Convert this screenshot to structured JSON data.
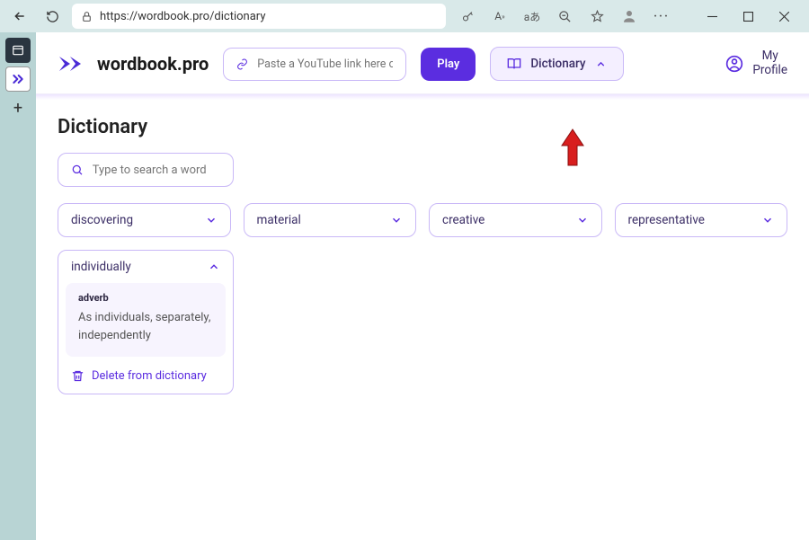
{
  "browser": {
    "url": "https://wordbook.pro/dictionary"
  },
  "header": {
    "logo_text": "wordbook.pro",
    "paste_placeholder": "Paste a YouTube link here or",
    "play_label": "Play",
    "dictionary_label": "Dictionary",
    "profile_line1": "My",
    "profile_line2": "Profile"
  },
  "page": {
    "title": "Dictionary",
    "search_placeholder": "Type to search a word",
    "words": [
      "discovering",
      "material",
      "creative",
      "representative"
    ],
    "expanded": {
      "word": "individually",
      "pos": "adverb",
      "definition": "As individuals, separately, independently",
      "delete_label": "Delete from dictionary"
    }
  }
}
